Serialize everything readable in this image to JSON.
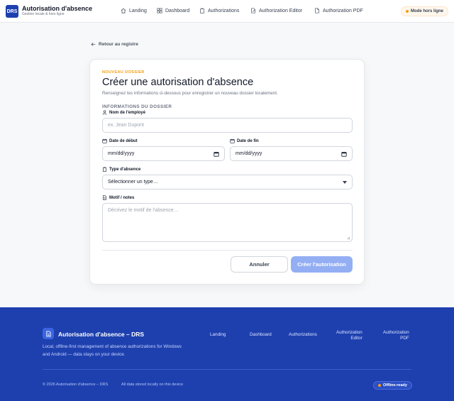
{
  "header": {
    "logo_text": "DRS",
    "title": "Autorisation d'absence",
    "subtitle": "Gestion locale & hors ligne",
    "nav": [
      {
        "label": "Landing",
        "icon": "home-icon"
      },
      {
        "label": "Dashboard",
        "icon": "grid-icon"
      },
      {
        "label": "Authorizations",
        "icon": "clipboard-icon"
      },
      {
        "label": "Authorization Editor",
        "icon": "edit-document-icon"
      },
      {
        "label": "Authorization PDF",
        "icon": "file-icon"
      }
    ],
    "offline_mode": "Mode hors ligne"
  },
  "back_link": "Retour au registre",
  "form": {
    "eyebrow": "NOUVEAU DOSSIER",
    "title": "Créer une autorisation d'absence",
    "subtitle": "Renseignez les informations ci-dessous pour enregistrer un nouveau dossier localement.",
    "section_title": "INFORMATIONS DU DOSSIER",
    "employee_label": "Nom de l'employé",
    "employee_placeholder": "ex. Jean Dupont",
    "start_label": "Date de début",
    "start_value": "mm/dd/yyyy",
    "end_label": "Date de fin",
    "end_value": "mm/dd/yyyy",
    "type_label": "Type d'absence",
    "type_value": "Sélectionner un type…",
    "notes_label": "Motif / notes",
    "notes_placeholder": "Décrivez le motif de l'absence…",
    "cancel_label": "Annuler",
    "submit_label": "Créer l'autorisation"
  },
  "footer": {
    "title": "Autorisation d'absence – DRS",
    "description": "Local, offline-first management of absence authorizations for Windows and Android — data stays on your device.",
    "links": {
      "landing": "Landing",
      "dashboard": "Dashboard",
      "authorizations": "Authorizations",
      "editor_line1": "Authorization",
      "editor_line2": "Editor",
      "pdf_line1": "Authorization",
      "pdf_line2": "PDF"
    },
    "copyright": "© 2026 Autorisation d'absence – DRS",
    "local_note": "All data stored locally on this device",
    "badge": "Offline-ready"
  },
  "colors": {
    "brand": "#1e40af",
    "accent": "#f59e0b",
    "submit_disabled": "#93aef3"
  }
}
